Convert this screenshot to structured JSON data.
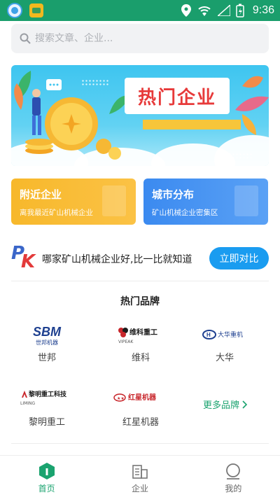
{
  "status_bar": {
    "time": "9:36"
  },
  "search": {
    "placeholder": "搜索文章、企业..."
  },
  "banner": {
    "title": "热门企业"
  },
  "cards": [
    {
      "title": "附近企业",
      "subtitle": "离我最近矿山机械企业"
    },
    {
      "title": "城市分布",
      "subtitle": "矿山机械企业密集区"
    }
  ],
  "compare": {
    "text": "哪家矿山机械企业好,比一比就知道",
    "button_label": "立即对比"
  },
  "brands": {
    "section_title": "热门品牌",
    "items": [
      {
        "name": "世邦",
        "logo_text": "SBM",
        "logo_sub": "世邦机器"
      },
      {
        "name": "维科",
        "logo_text": "维科重工",
        "logo_sub": "VIPEAK"
      },
      {
        "name": "大华",
        "logo_text": "大华重机",
        "logo_sub": ""
      },
      {
        "name": "黎明重工",
        "logo_text": "黎明重工科技",
        "logo_sub": "LIMING"
      },
      {
        "name": "红星机器",
        "logo_text": "红星机器",
        "logo_sub": ""
      }
    ],
    "more_label": "更多品牌"
  },
  "nav": {
    "items": [
      {
        "label": "首页"
      },
      {
        "label": "企业"
      },
      {
        "label": "我的"
      }
    ]
  },
  "colors": {
    "brand_green": "#1aa36f",
    "accent_blue": "#1a9cf0",
    "orange": "#f7b82b"
  }
}
